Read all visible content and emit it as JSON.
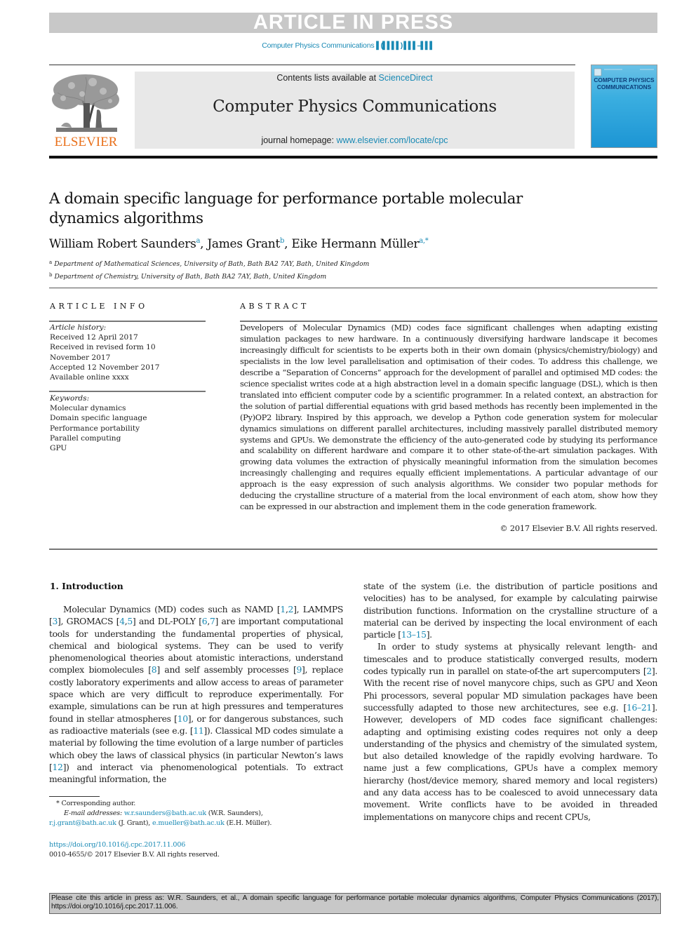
{
  "banner": {
    "text": "ARTICLE IN PRESS",
    "journal_ref": "Computer Physics Communications",
    "journal_ref_bars": "▌(▌▌▌▌) ▌▌▌–▌▌▌"
  },
  "header": {
    "publisher_logo_text": "ELSEVIER",
    "contents_prefix": "Contents lists available at ",
    "contents_link": "ScienceDirect",
    "journal_name": "Computer Physics Communications",
    "homepage_prefix": "journal homepage: ",
    "homepage_link": "www.elsevier.com/locate/cpc",
    "cover_title_line1": "COMPUTER PHYSICS",
    "cover_title_line2": "COMMUNICATIONS"
  },
  "article": {
    "title": "A domain specific language for performance portable molecular dynamics algorithms",
    "authors": [
      {
        "name": "William Robert Saunders",
        "sup": "a"
      },
      {
        "name": "James Grant",
        "sup": "b"
      },
      {
        "name": "Eike Hermann Müller",
        "sup": "a,*"
      }
    ],
    "affiliations": [
      {
        "sup": "a",
        "text": "Department of Mathematical Sciences, University of Bath, Bath BA2 7AY, Bath, United Kingdom"
      },
      {
        "sup": "b",
        "text": "Department of Chemistry, University of Bath, Bath BA2 7AY, Bath, United Kingdom"
      }
    ]
  },
  "article_info": {
    "label": "ARTICLE INFO",
    "history_label": "Article history:",
    "history": [
      "Received 12 April 2017",
      "Received in revised form 10 November 2017",
      "Accepted 12 November 2017",
      "Available online xxxx"
    ],
    "keywords_label": "Keywords:",
    "keywords": [
      "Molecular dynamics",
      "Domain specific language",
      "Performance portability",
      "Parallel computing",
      "GPU"
    ]
  },
  "abstract": {
    "label": "ABSTRACT",
    "text": "Developers of Molecular Dynamics (MD) codes face significant challenges when adapting existing simulation packages to new hardware. In a continuously diversifying hardware landscape it becomes increasingly difficult for scientists to be experts both in their own domain (physics/chemistry/biology) and specialists in the low level parallelisation and optimisation of their codes. To address this challenge, we describe a “Separation of Concerns” approach for the development of parallel and optimised MD codes: the science specialist writes code at a high abstraction level in a domain specific language (DSL), which is then translated into efficient computer code by a scientific programmer. In a related context, an abstraction for the solution of partial differential equations with grid based methods has recently been implemented in the (Py)OP2 library. Inspired by this approach, we develop a Python code generation system for molecular dynamics simulations on different parallel architectures, including massively parallel distributed memory systems and GPUs. We demonstrate the efficiency of the auto-generated code by studying its performance and scalability on different hardware and compare it to other state-of-the-art simulation packages. With growing data volumes the extraction of physically meaningful information from the simulation becomes increasingly challenging and requires equally efficient implementations. A particular advantage of our approach is the easy expression of such analysis algorithms. We consider two popular methods for deducing the crystalline structure of a material from the local environment of each atom, show how they can be expressed in our abstraction and implement them in the code generation framework.",
    "copyright": "© 2017 Elsevier B.V. All rights reserved."
  },
  "body": {
    "section_heading": "1. Introduction",
    "left_column": [
      {
        "t": "Molecular Dynamics (MD) codes such as NAMD ["
      },
      {
        "c": "1"
      },
      {
        "t": ","
      },
      {
        "c": "2"
      },
      {
        "t": "], LAMMPS ["
      },
      {
        "c": "3"
      },
      {
        "t": "], GROMACS ["
      },
      {
        "c": "4"
      },
      {
        "t": ","
      },
      {
        "c": "5"
      },
      {
        "t": "] and DL-POLY ["
      },
      {
        "c": "6"
      },
      {
        "t": ","
      },
      {
        "c": "7"
      },
      {
        "t": "] are important computa­tional tools for understanding the fundamental properties of phys­ical, chemical and biological systems. They can be used to verify phenomenological theories about atomistic interactions, under­stand complex biomolecules ["
      },
      {
        "c": "8"
      },
      {
        "t": "] and self assembly processes ["
      },
      {
        "c": "9"
      },
      {
        "t": "], replace costly laboratory experiments and allow access to areas of parameter space which are very difficult to reproduce experimen­tally. For example, simulations can be run at high pressures and temperatures found in stellar atmospheres ["
      },
      {
        "c": "10"
      },
      {
        "t": "], or for dangerous substances, such as radioactive materials (see e.g. ["
      },
      {
        "c": "11"
      },
      {
        "t": "]). Classical MD codes simulate a material by following the time evolution of a large number of particles which obey the laws of classical physics (in particular Newton’s laws ["
      },
      {
        "c": "12"
      },
      {
        "t": "]) and interact via phe­nomenological potentials. To extract meaningful information, the"
      }
    ],
    "right_column_p1": [
      {
        "t": "state of the system (i.e. the distribution of particle positions and velocities) has to be analysed, for example by calculating pairwise distribution functions. Information on the crystalline structure of a material can be derived by inspecting the local environment of each particle ["
      },
      {
        "c": "13–15"
      },
      {
        "t": "]."
      }
    ],
    "right_column_p2": [
      {
        "t": "In order to study systems at physically relevant length- and timescales and to produce statistically converged results, modern codes typically run in parallel on state-of-the art supercomput­ers ["
      },
      {
        "c": "2"
      },
      {
        "t": "]. With the recent rise of novel manycore chips, such as GPU and Xeon Phi processors, several popular MD simulation packages have been successfully adapted to those new architectures, see e.g. ["
      },
      {
        "c": "16–21"
      },
      {
        "t": "]. However, developers of MD codes face significant challenges: adapting and optimising existing codes requires not only a deep understanding of the physics and chemistry of the simulated system, but also detailed knowledge of the rapidly evolving hardware. To name just a few complications, GPUs have a complex memory hierarchy (host/device memory, shared memory and local registers) and any data access has to be coalesced to avoid unnecessary data movement. Write conflicts have to be avoided in threaded implementations on manycore chips and recent CPUs,"
      }
    ]
  },
  "footnotes": {
    "corresponding_mark": "*",
    "corresponding_text": "Corresponding author.",
    "email_label": "E-mail addresses:",
    "emails": [
      {
        "address": "w.r.saunders@bath.ac.uk",
        "name": " (W.R. Saunders),"
      },
      {
        "address": "r.j.grant@bath.ac.uk",
        "name": " (J. Grant), "
      },
      {
        "address": "e.mueller@bath.ac.uk",
        "name": " (E.H. Müller)."
      }
    ],
    "doi": "https://doi.org/10.1016/j.cpc.2017.11.006",
    "issn_copyright": "0010-4655/© 2017 Elsevier B.V. All rights reserved."
  },
  "cite_box": {
    "text": "Please cite this article in press as: W.R. Saunders, et al., A domain specific language for performance portable molecular dynamics algorithms, Computer Physics Communications (2017), https://doi.org/10.1016/j.cpc.2017.11.006."
  },
  "colors": {
    "link": "#1a8ab5",
    "elsevier_orange": "#e9711c",
    "banner_gray": "#c8c8c8",
    "masthead_gray": "#e8e8e8"
  }
}
